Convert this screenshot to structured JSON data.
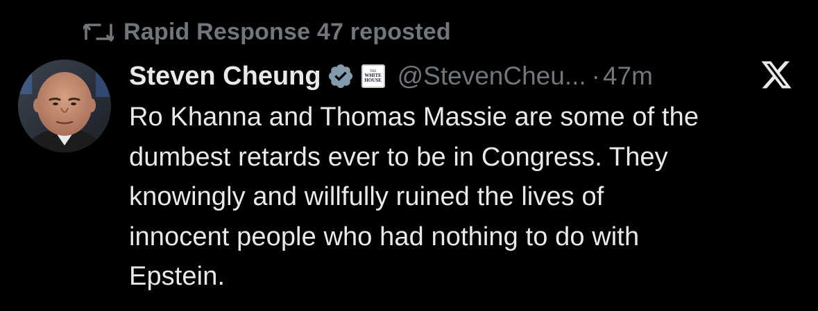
{
  "repost": {
    "label": "Rapid Response 47 reposted",
    "icon": "repost-icon"
  },
  "author": {
    "display_name": "Steven Cheung",
    "verified_icon": "verified-badge-icon",
    "affiliate_badge": {
      "line1": "The",
      "line2": "White",
      "line3": "House"
    },
    "handle": "@StevenCheu...",
    "separator": "·",
    "timestamp": "47m"
  },
  "tweet": {
    "lines": [
      "Ro Khanna and Thomas Massie are some of the",
      "dumbest retards ever to be in Congress. They",
      "knowingly and willfully ruined the lives of",
      "innocent people who had nothing to do with",
      "Epstein."
    ]
  },
  "colors": {
    "background": "#000000",
    "primary_text": "#e7e9ea",
    "secondary_text": "#71767b",
    "verified_gray": "#829aab"
  },
  "icons": {
    "x_logo": "x-logo-icon",
    "avatar": "avatar"
  }
}
